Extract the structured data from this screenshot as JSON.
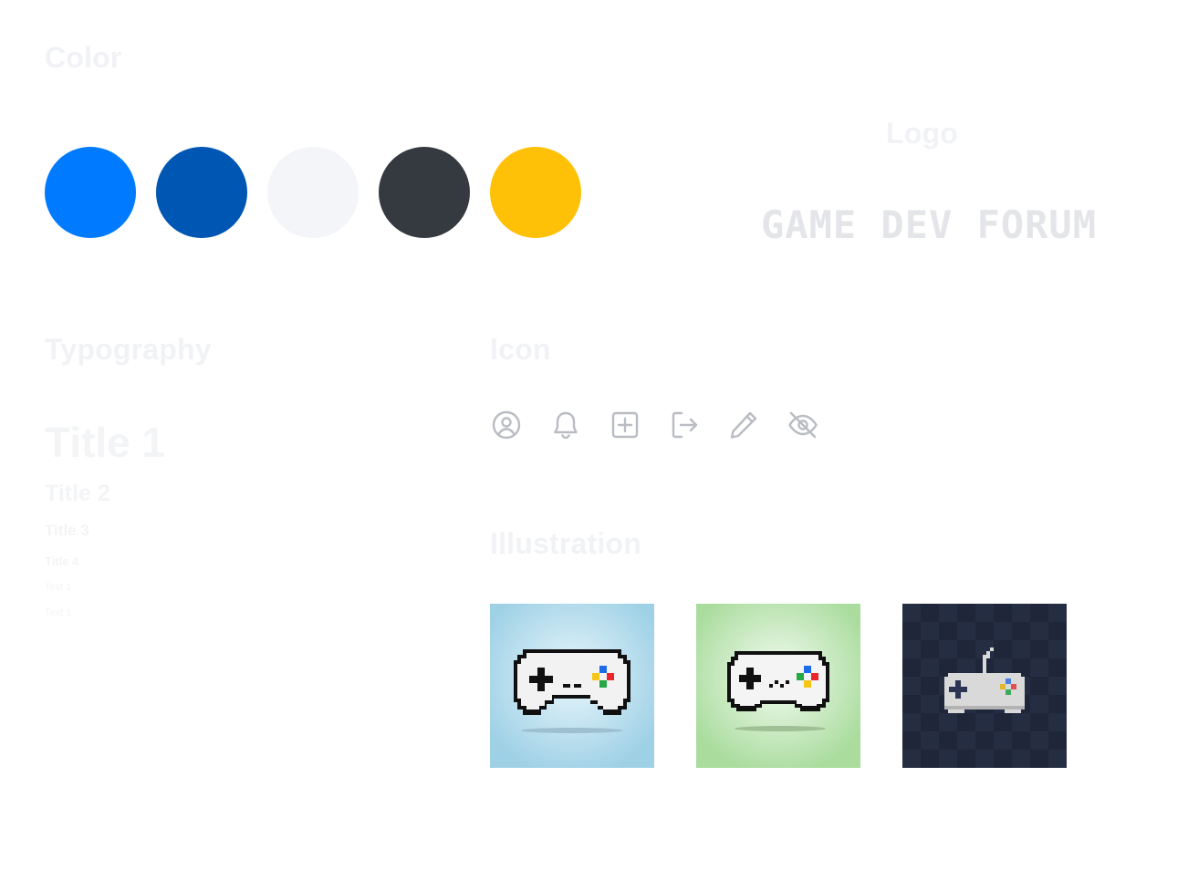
{
  "sections": {
    "color": "Color",
    "logo": "Logo",
    "typography": "Typography",
    "icon": "Icon",
    "illustration": "Illustration"
  },
  "palette": [
    "#007bff",
    "#0056b3",
    "#f4f5f9",
    "#343a40",
    "#ffc107"
  ],
  "logo": {
    "text": "GAME DEV FORUM"
  },
  "typography": {
    "title1": "Title 1",
    "title2": "Title 2",
    "title3": "Title 3",
    "title4": "Title 4",
    "text1": "Text 1",
    "text2": "Text 1"
  },
  "icons": [
    "user-circle-icon",
    "bell-icon",
    "plus-square-icon",
    "logout-icon",
    "pencil-icon",
    "eye-off-icon"
  ],
  "illustrations": [
    {
      "name": "gamepad-blue-background",
      "background": "#a8d8ea"
    },
    {
      "name": "gamepad-green-background",
      "background": "#b2dfa6"
    },
    {
      "name": "gamepad-dark-background",
      "background": "#1f263a"
    }
  ],
  "colors": {
    "icon_stroke": "#b9bcc2",
    "heading": "#f1f2f5"
  }
}
